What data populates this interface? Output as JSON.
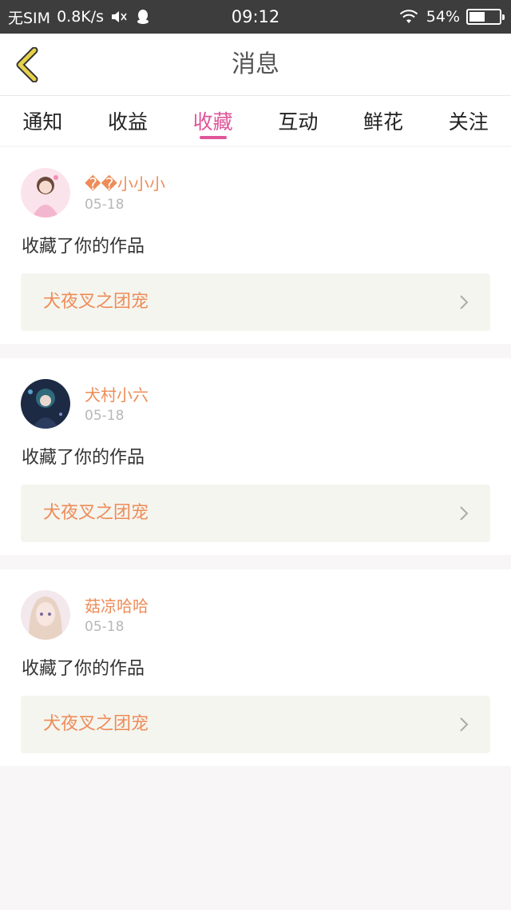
{
  "status_bar": {
    "carrier": "无SIM",
    "speed": "0.8K/s",
    "time": "09:12",
    "battery": "54%",
    "battery_level": 0.54,
    "icons": [
      "mute-icon",
      "qq-icon",
      "wifi-icon",
      "battery-icon"
    ]
  },
  "header": {
    "title": "消息",
    "back_icon": "chevron-left-icon"
  },
  "tabs": [
    {
      "label": "通知",
      "active": false
    },
    {
      "label": "收益",
      "active": false
    },
    {
      "label": "收藏",
      "active": true
    },
    {
      "label": "互动",
      "active": false
    },
    {
      "label": "鲜花",
      "active": false
    },
    {
      "label": "关注",
      "active": false
    }
  ],
  "messages": [
    {
      "username": "��小小小",
      "date": "05-18",
      "action": "收藏了你的作品",
      "work": "犬夜叉之团宠"
    },
    {
      "username": "犬村小六",
      "date": "05-18",
      "action": "收藏了你的作品",
      "work": "犬夜叉之团宠"
    },
    {
      "username": "菇凉哈哈",
      "date": "05-18",
      "action": "收藏了你的作品",
      "work": "犬夜叉之团宠"
    }
  ],
  "colors": {
    "accent": "#e0559a",
    "username": "#ee8c58",
    "status_bar": "#3d3d3d",
    "work_bg": "#f5f5ef",
    "back_icon": "#e6d24a"
  }
}
